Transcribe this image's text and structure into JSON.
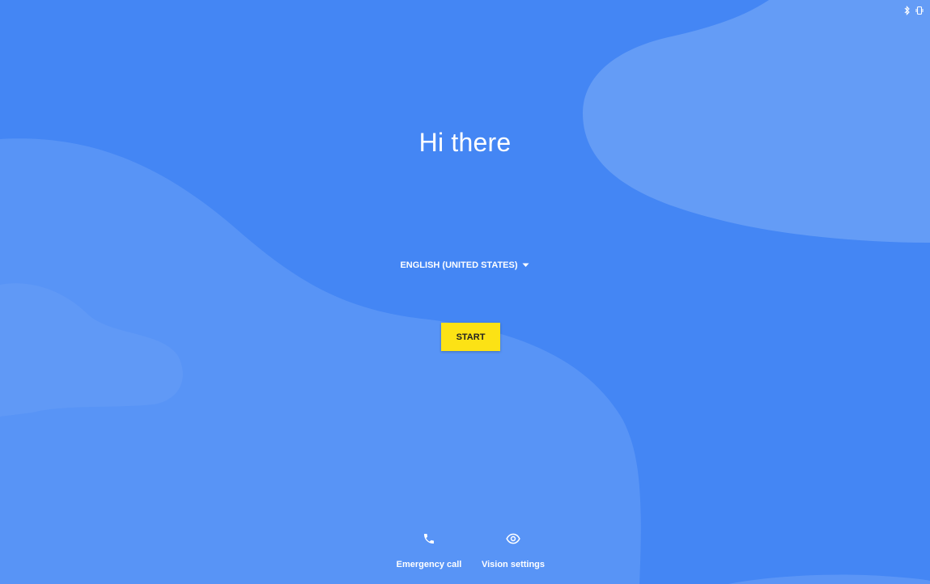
{
  "status_bar": {
    "icons": [
      "bluetooth-icon",
      "vibrate-icon"
    ]
  },
  "welcome": {
    "greeting": "Hi there",
    "language": "ENGLISH (UNITED STATES)",
    "start_label": "START"
  },
  "bottom_actions": [
    {
      "label": "Emergency call",
      "icon": "phone-icon"
    },
    {
      "label": "Vision settings",
      "icon": "eye-icon"
    }
  ],
  "colors": {
    "background": "#4486f4",
    "shape_light": "#6aa0f6",
    "start_button": "#fce215",
    "text": "#ffffff"
  }
}
